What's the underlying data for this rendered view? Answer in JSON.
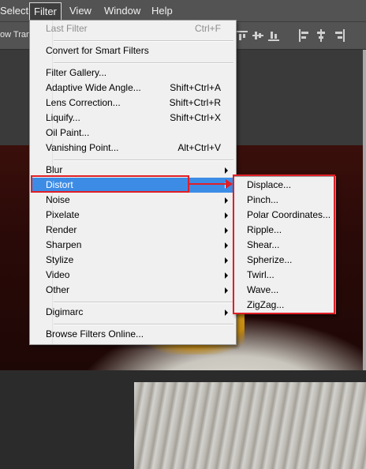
{
  "menubar": {
    "items": [
      "Select",
      "Filter",
      "View",
      "Window",
      "Help"
    ]
  },
  "optionsbar": {
    "label": "ow Trans"
  },
  "filter_menu": {
    "last_filter": {
      "label": "Last Filter",
      "shortcut": "Ctrl+F"
    },
    "convert": {
      "label": "Convert for Smart Filters"
    },
    "filter_gallery": {
      "label": "Filter Gallery..."
    },
    "adaptive_wide_angle": {
      "label": "Adaptive Wide Angle...",
      "shortcut": "Shift+Ctrl+A"
    },
    "lens_correction": {
      "label": "Lens Correction...",
      "shortcut": "Shift+Ctrl+R"
    },
    "liquify": {
      "label": "Liquify...",
      "shortcut": "Shift+Ctrl+X"
    },
    "oil_paint": {
      "label": "Oil Paint..."
    },
    "vanishing_point": {
      "label": "Vanishing Point...",
      "shortcut": "Alt+Ctrl+V"
    },
    "blur": {
      "label": "Blur"
    },
    "distort": {
      "label": "Distort"
    },
    "noise": {
      "label": "Noise"
    },
    "pixelate": {
      "label": "Pixelate"
    },
    "render": {
      "label": "Render"
    },
    "sharpen": {
      "label": "Sharpen"
    },
    "stylize": {
      "label": "Stylize"
    },
    "video": {
      "label": "Video"
    },
    "other": {
      "label": "Other"
    },
    "digimarc": {
      "label": "Digimarc"
    },
    "browse": {
      "label": "Browse Filters Online..."
    }
  },
  "distort_submenu": {
    "items": [
      "Displace...",
      "Pinch...",
      "Polar Coordinates...",
      "Ripple...",
      "Shear...",
      "Spherize...",
      "Twirl...",
      "Wave...",
      "ZigZag..."
    ]
  },
  "colors": {
    "highlight": "#3c8ce6",
    "annotation": "#e01f26",
    "menu_bg": "#f0f0f0",
    "menubar_bg": "#535353"
  }
}
